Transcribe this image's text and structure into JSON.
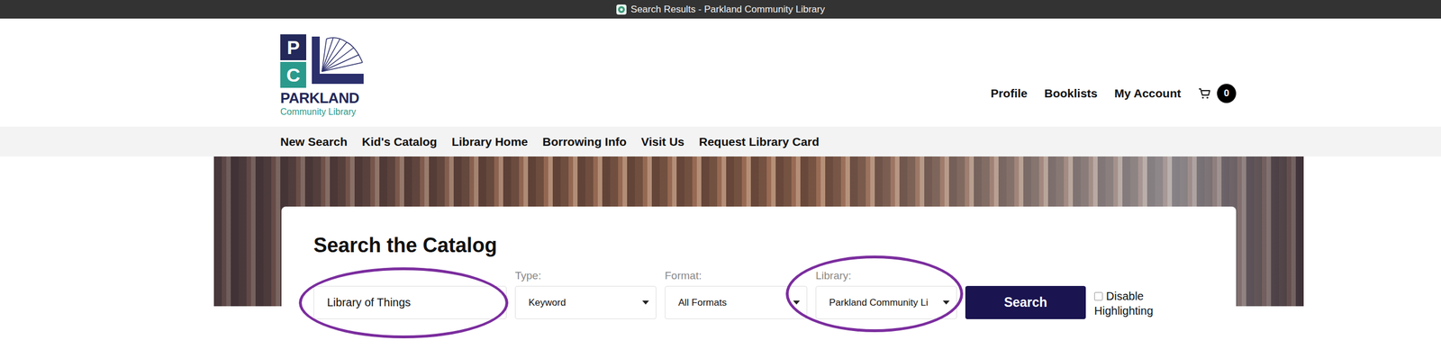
{
  "window": {
    "title": "Search Results - Parkland Community Library"
  },
  "logo": {
    "letters": [
      "P",
      "C"
    ],
    "name": "PARKLAND",
    "subtitle": "Community Library"
  },
  "account_nav": {
    "items": [
      "Profile",
      "Booklists",
      "My Account"
    ],
    "cart_count": "0"
  },
  "main_nav": {
    "items": [
      "New Search",
      "Kid's Catalog",
      "Library Home",
      "Borrowing Info",
      "Visit Us",
      "Request Library Card"
    ]
  },
  "search": {
    "heading": "Search the Catalog",
    "fields": [
      {
        "kind": "text",
        "label": "",
        "value": "Library of Things",
        "circled": true
      },
      {
        "kind": "select",
        "label": "Type:",
        "value": "Keyword",
        "circled": false
      },
      {
        "kind": "select",
        "label": "Format:",
        "value": "All Formats",
        "circled": false
      },
      {
        "kind": "select",
        "label": "Library:",
        "value": "Parkland Community Li",
        "circled": true
      }
    ],
    "button": "Search",
    "highlight_option": {
      "label": "Disable Highlighting",
      "checked": false
    }
  }
}
